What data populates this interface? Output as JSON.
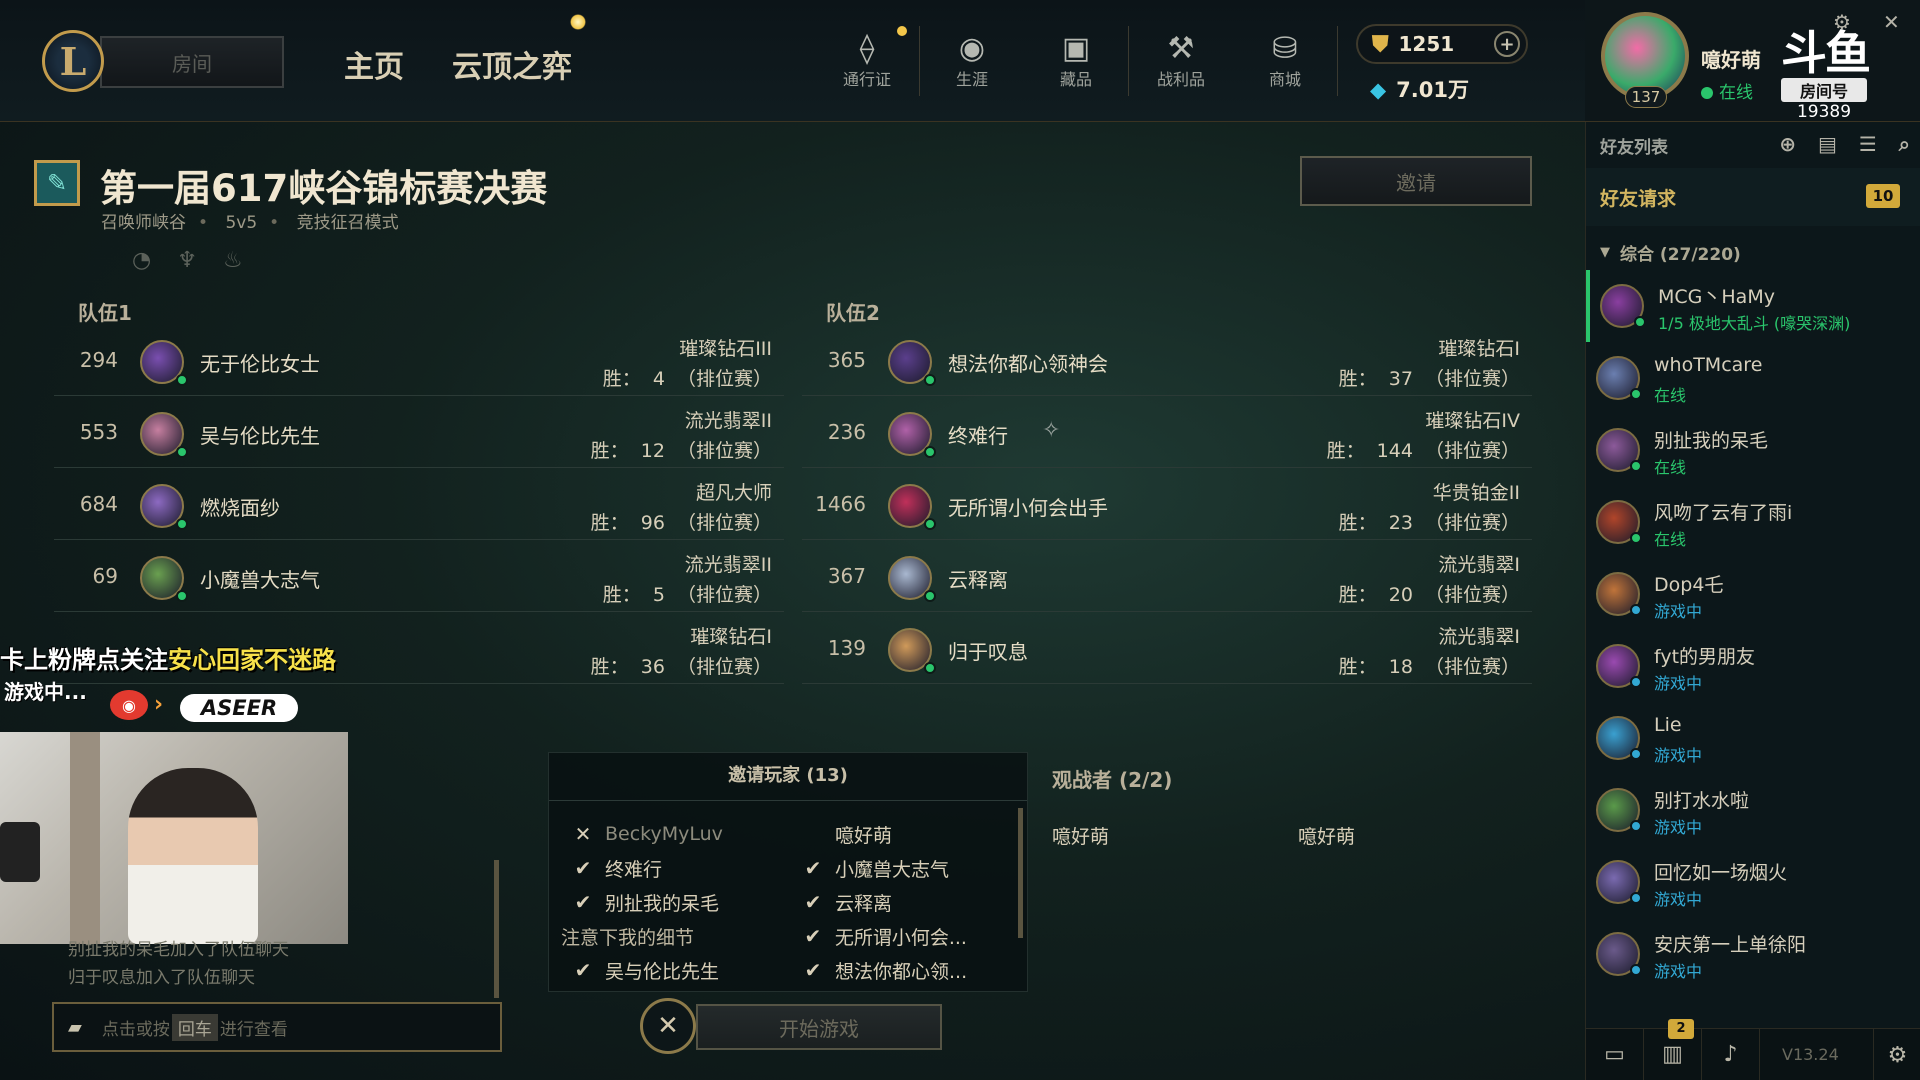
{
  "topnav": {
    "room_button": "房间",
    "home": "主页",
    "tft": "云顶之弈",
    "icons": [
      {
        "label": "通行证",
        "icon": "pass-icon",
        "glyph": "⟠"
      },
      {
        "label": "生涯",
        "icon": "profile-icon",
        "glyph": "◉"
      },
      {
        "label": "藏品",
        "icon": "collection-icon",
        "glyph": "▣"
      },
      {
        "label": "战利品",
        "icon": "loot-icon",
        "glyph": "⚒"
      },
      {
        "label": "商城",
        "icon": "store-icon",
        "glyph": "⛁"
      }
    ],
    "rp": "1251",
    "be": "7.01万"
  },
  "profile": {
    "level": "137",
    "name": "噫好萌",
    "status": "在线"
  },
  "stream": {
    "logo": "斗鱼",
    "room_tag": "房间号",
    "room_number": "19389",
    "overlay_line1": "卡上粉牌点关注",
    "overlay_line1_highlight": "安心回家不迷路",
    "overlay_line2": "游戏中...",
    "brand": "ASEER"
  },
  "lobby": {
    "title": "第一届617峡谷锦标赛决赛",
    "map": "召唤师峡谷",
    "size": "5v5",
    "mode": "竞技征召模式",
    "invite_button": "邀请"
  },
  "team1": {
    "label": "队伍1",
    "players": [
      {
        "level": "294",
        "name": "无于伦比女士",
        "rank": "璀璨钻石III",
        "wins": "胜：  4  （排位赛）",
        "color": "#7a4fb0"
      },
      {
        "level": "553",
        "name": "吴与伦比先生",
        "rank": "流光翡翠II",
        "wins": "胜：  12  （排位赛）",
        "color": "#c67fa0"
      },
      {
        "level": "684",
        "name": "燃烧面纱",
        "rank": "超凡大师",
        "wins": "胜：  96  （排位赛）",
        "color": "#8d6ac2"
      },
      {
        "level": "69",
        "name": "小魔兽大志气",
        "rank": "流光翡翠II",
        "wins": "胜：  5  （排位赛）",
        "color": "#6aa050"
      },
      {
        "level": "",
        "name": "",
        "rank": "璀璨钻石I",
        "wins": "胜：  36  （排位赛）",
        "color": "#555"
      }
    ]
  },
  "team2": {
    "label": "队伍2",
    "players": [
      {
        "level": "365",
        "name": "想法你都心领神会",
        "rank": "璀璨钻石I",
        "wins": "胜：  37  （排位赛）",
        "color": "#5b3f8c"
      },
      {
        "level": "236",
        "name": "终难行",
        "rank": "璀璨钻石IV",
        "wins": "胜：  144  （排位赛）",
        "color": "#b061a8",
        "emblem": "✧"
      },
      {
        "level": "1466",
        "name": "无所谓小何会出手",
        "rank": "华贵铂金II",
        "wins": "胜：  23  （排位赛）",
        "color": "#c0305a"
      },
      {
        "level": "367",
        "name": "云释离",
        "rank": "流光翡翠I",
        "wins": "胜：  20  （排位赛）",
        "color": "#a9b8d0"
      },
      {
        "level": "139",
        "name": "归于叹息",
        "rank": "流光翡翠I",
        "wins": "胜：  18  （排位赛）",
        "color": "#d09a5a"
      }
    ]
  },
  "chat": {
    "lines": [
      "别扯我的呆毛加入了队伍聊天",
      "归于叹息加入了队伍聊天"
    ],
    "input_prefix": "点击或按",
    "input_key": "回车",
    "input_suffix": "进行查看"
  },
  "invite": {
    "header": "邀请玩家 (13)",
    "rows": [
      [
        {
          "mark": "✕",
          "name": "BeckyMyLuv",
          "style": "gray"
        },
        {
          "mark": "",
          "name": "噫好萌",
          "style": ""
        }
      ],
      [
        {
          "mark": "✔",
          "name": "终难行",
          "style": ""
        },
        {
          "mark": "✔",
          "name": "小魔兽大志气",
          "style": ""
        }
      ],
      [
        {
          "mark": "✔",
          "name": "别扯我的呆毛",
          "style": ""
        },
        {
          "mark": "✔",
          "name": "云释离",
          "style": ""
        }
      ],
      [
        {
          "mark": "",
          "name": "注意下我的细节",
          "style": "note"
        },
        {
          "mark": "✔",
          "name": "无所谓小何会...",
          "style": ""
        }
      ],
      [
        {
          "mark": "✔",
          "name": "吴与伦比先生",
          "style": ""
        },
        {
          "mark": "✔",
          "name": "想法你都心领...",
          "style": ""
        }
      ]
    ]
  },
  "spectators": {
    "title": "观战者 (2/2)",
    "names": [
      "噫好萌",
      "噫好萌"
    ]
  },
  "start": {
    "label": "开始游戏"
  },
  "social": {
    "title": "好友列表",
    "friend_requests": "好友请求",
    "friend_requests_count": "10",
    "group": "综合 (27/220)",
    "friends": [
      {
        "name": "MCG丶HaMy",
        "status": "1/5 极地大乱斗 (嚎哭深渊)",
        "type": "online",
        "color": "#8a3fa0",
        "active": true
      },
      {
        "name": "whoTMcare",
        "status": "在线",
        "type": "online",
        "color": "#6b7fb0",
        "active": false
      },
      {
        "name": "别扯我的呆毛",
        "status": "在线",
        "type": "online",
        "color": "#8c5a9a",
        "active": false
      },
      {
        "name": "风吻了云有了雨i",
        "status": "在线",
        "type": "online",
        "color": "#b0452a",
        "active": false
      },
      {
        "name": "Dop4乇",
        "status": "游戏中",
        "type": "ingame",
        "color": "#c0743a",
        "active": false
      },
      {
        "name": "fyt的男朋友",
        "status": "游戏中",
        "type": "ingame",
        "color": "#9a4ab0",
        "active": false
      },
      {
        "name": "Lie",
        "status": "游戏中",
        "type": "ingame",
        "color": "#3aa0d0",
        "active": false
      },
      {
        "name": "别打水水啦",
        "status": "游戏中",
        "type": "ingame",
        "color": "#5a9a4a",
        "active": false
      },
      {
        "name": "回忆如一场烟火",
        "status": "游戏中",
        "type": "ingame",
        "color": "#7a6ab0",
        "active": false
      },
      {
        "name": "安庆第一上单徐阳",
        "status": "游戏中",
        "type": "ingame",
        "color": "#6a5a8a",
        "active": false
      }
    ],
    "footer_badge": "2",
    "version": "V13.24"
  }
}
